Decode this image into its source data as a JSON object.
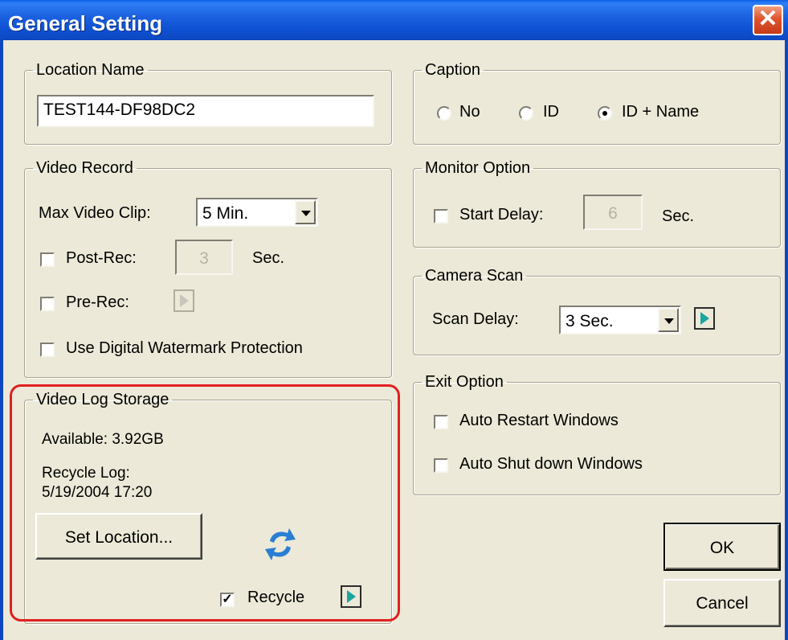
{
  "window": {
    "title": "General Setting",
    "close_glyph": "✕"
  },
  "location_name": {
    "legend": "Location Name",
    "value": "TEST144-DF98DC2"
  },
  "caption": {
    "legend": "Caption",
    "options": [
      {
        "label": "No",
        "selected": false
      },
      {
        "label": "ID",
        "selected": false
      },
      {
        "label": "ID + Name",
        "selected": true
      }
    ]
  },
  "video_record": {
    "legend": "Video Record",
    "max_clip_label": "Max Video Clip:",
    "max_clip_value": "5 Min.",
    "post_rec_label": "Post-Rec:",
    "post_rec_value": "3",
    "post_rec_unit": "Sec.",
    "pre_rec_label": "Pre-Rec:",
    "watermark_label": "Use Digital Watermark Protection"
  },
  "monitor_option": {
    "legend": "Monitor Option",
    "start_delay_label": "Start Delay:",
    "start_delay_value": "6",
    "unit": "Sec."
  },
  "camera_scan": {
    "legend": "Camera Scan",
    "scan_delay_label": "Scan Delay:",
    "scan_delay_value": "3 Sec."
  },
  "exit_option": {
    "legend": "Exit Option",
    "auto_restart_label": "Auto Restart Windows",
    "auto_shutdown_label": "Auto Shut down Windows"
  },
  "video_log_storage": {
    "legend": "Video Log Storage",
    "available": "Available: 3.92GB",
    "recycle_log_label": "Recycle Log:",
    "recycle_log_date": "5/19/2004 17:20",
    "set_location_label": "Set Location...",
    "recycle_label": "Recycle",
    "recycle_checked": true
  },
  "buttons": {
    "ok": "OK",
    "cancel": "Cancel"
  },
  "colors": {
    "title_bar": "#0c47c0",
    "highlight": "#e02020",
    "play_icon": "#1aa5a0",
    "recycle_icon": "#2a7fd4"
  }
}
